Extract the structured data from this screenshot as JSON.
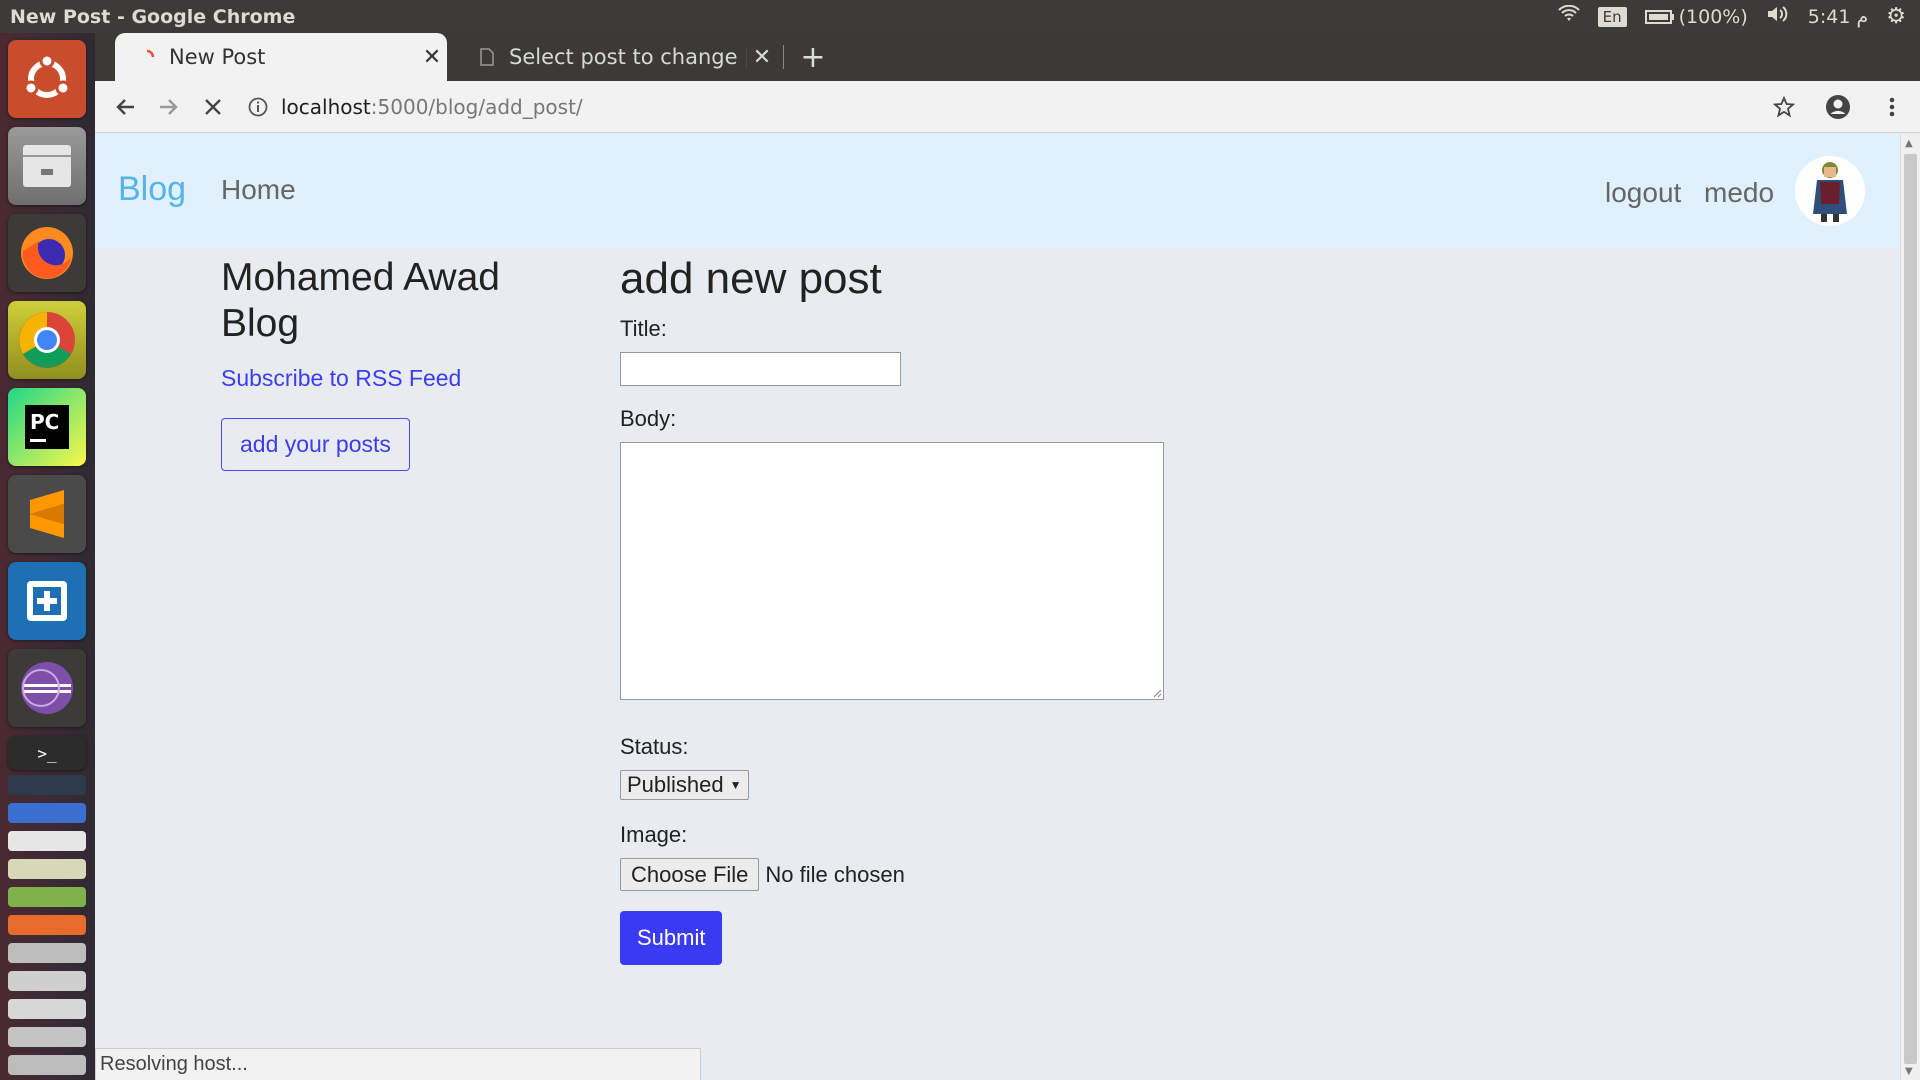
{
  "os": {
    "window_title": "New Post - Google Chrome",
    "tray": {
      "lang": "En",
      "battery": "(100%)",
      "clock": "م 5:41"
    }
  },
  "browser": {
    "tabs": [
      {
        "label": "New Post",
        "active": true
      },
      {
        "label": "Select post to change | Dj",
        "active": false
      }
    ],
    "url_host": "localhost",
    "url_path": ":5000/blog/add_post/",
    "status_bubble": "Resolving host..."
  },
  "nav": {
    "brand": "Blog",
    "home": "Home",
    "logout": "logout",
    "user": "medo"
  },
  "sidebar": {
    "title": "Mohamed Awad Blog",
    "rss_link": "Subscribe to RSS Feed",
    "add_posts_button": "add your posts"
  },
  "form": {
    "heading": "add new post",
    "title_label": "Title:",
    "title_value": "",
    "body_label": "Body:",
    "body_value": "",
    "status_label": "Status:",
    "status_selected": "Published",
    "image_label": "Image:",
    "choose_file": "Choose File",
    "file_status": "No file chosen",
    "submit": "Submit"
  },
  "colors": {
    "brand": "#56b5e6",
    "link": "#3d3df0",
    "submit_bg": "#3a3af2",
    "navbar_bg": "#e0f0fd"
  }
}
